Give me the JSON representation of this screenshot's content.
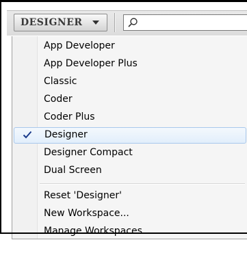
{
  "workspace_switcher": {
    "current": "DESIGNER",
    "search_placeholder": ""
  },
  "menu": {
    "items": [
      {
        "label": "App Developer",
        "checked": false
      },
      {
        "label": "App Developer Plus",
        "checked": false
      },
      {
        "label": "Classic",
        "checked": false
      },
      {
        "label": "Coder",
        "checked": false
      },
      {
        "label": "Coder Plus",
        "checked": false
      },
      {
        "label": "Designer",
        "checked": true
      },
      {
        "label": "Designer Compact",
        "checked": false
      },
      {
        "label": "Dual Screen",
        "checked": false
      }
    ],
    "actions": [
      {
        "label": "Reset 'Designer'"
      },
      {
        "label": "New Workspace..."
      },
      {
        "label": "Manage Workspaces..."
      }
    ]
  },
  "icons": {
    "search": "search-icon",
    "dropdown": "chevron-down-icon",
    "check": "checkmark-icon"
  },
  "colors": {
    "selection_fill": "#e2eefb",
    "selection_border": "#a8c8ec",
    "check": "#1a3a8a"
  }
}
